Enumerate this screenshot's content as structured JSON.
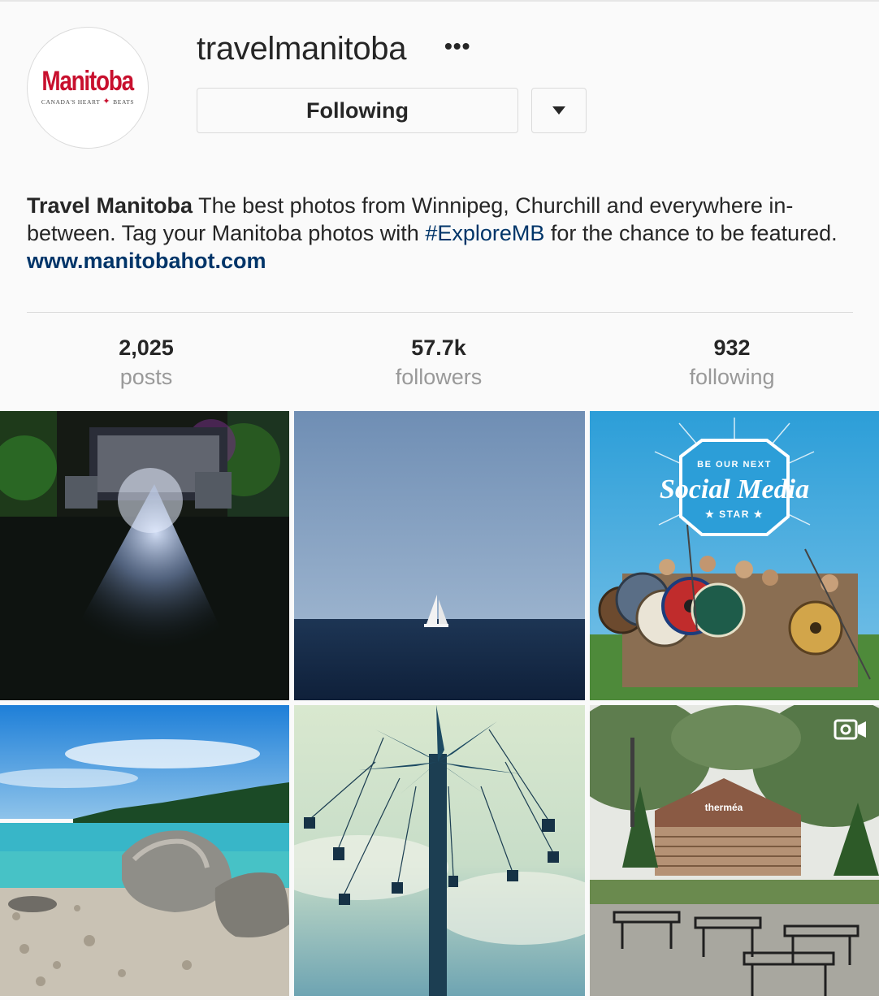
{
  "profile": {
    "username": "travelmanitoba",
    "more_icon": "ellipsis-icon",
    "avatar_text": "Manitoba",
    "avatar_tagline_left": "Canada's Heart",
    "avatar_tagline_right": "Beats",
    "following_label": "Following",
    "dropdown_icon": "caret-down-icon"
  },
  "bio": {
    "name": "Travel Manitoba",
    "text_1": " The best photos from Winnipeg, Churchill and everywhere in-between. Tag your Manitoba photos with ",
    "hashtag": "#ExploreMB",
    "text_2": " for the chance to be featured. ",
    "link": "www.manitobahot.com"
  },
  "stats": [
    {
      "value": "2,025",
      "label": "posts"
    },
    {
      "value": "57.7k",
      "label": "followers"
    },
    {
      "value": "932",
      "label": "following"
    }
  ],
  "grid": {
    "tiles": [
      {
        "subject": "concert-crowd-stage-lights"
      },
      {
        "subject": "sailboat-on-lake"
      },
      {
        "subject": "viking-reenactors-social-media-graphic",
        "overlay": {
          "line_1": "BE OUR NEXT",
          "line_2": "Social Media",
          "line_3": "★ STAR ★"
        }
      },
      {
        "subject": "rocky-lake-shore"
      },
      {
        "subject": "swing-ride-amusement"
      },
      {
        "subject": "thermea-spa-patio",
        "sign": "therméa",
        "badge_icon": "video-camera-icon"
      }
    ]
  },
  "colors": {
    "accent_link": "#003569",
    "muted_text": "#999999",
    "border": "#dbdbdb",
    "brand_red": "#c8102e"
  }
}
